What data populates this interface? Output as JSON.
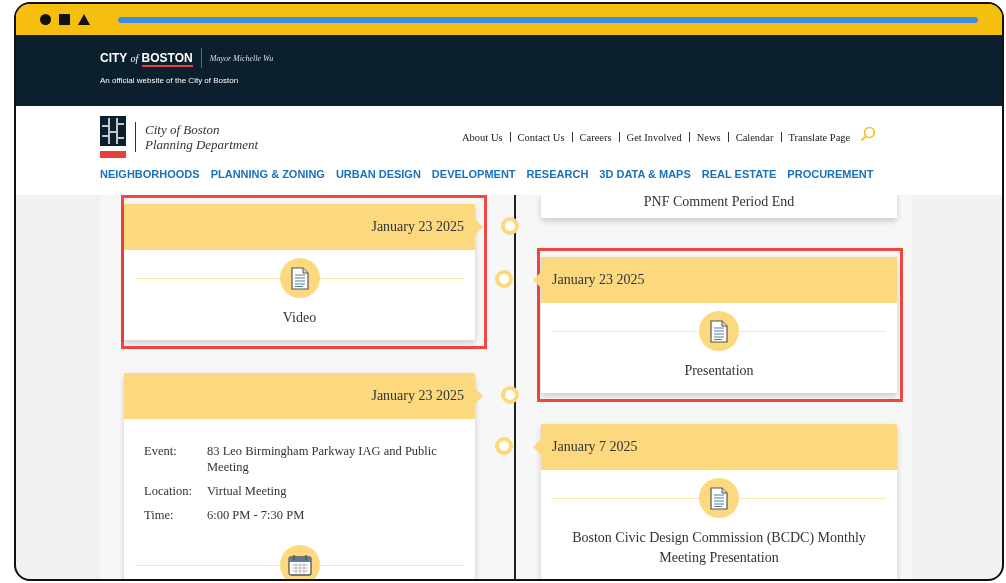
{
  "header": {
    "wordmark": {
      "city": "CITY",
      "of": "of",
      "boston": "BOSTON"
    },
    "mayor": "Mayor Michelle Wu",
    "tagline": "An official website of the City of Boston"
  },
  "nav": {
    "logo_lines": [
      "City of Boston",
      "Planning Department"
    ],
    "utility_links": [
      "About Us",
      "Contact Us",
      "Careers",
      "Get Involved",
      "News",
      "Calendar",
      "Translate Page"
    ],
    "menu": [
      "NEIGHBORHOODS",
      "PLANNING & ZONING",
      "URBAN DESIGN",
      "DEVELOPMENT",
      "RESEARCH",
      "3D DATA & MAPS",
      "REAL ESTATE",
      "PROCUREMENT"
    ]
  },
  "timeline": {
    "left": [
      {
        "kind": "document",
        "date": "January 23 2025",
        "title": "Video",
        "highlighted": true
      },
      {
        "kind": "details",
        "date": "January 23 2025",
        "highlighted": false,
        "details": [
          {
            "label": "Event:",
            "value": "83 Leo Birmingham Parkway IAG and Public Meeting"
          },
          {
            "label": "Location:",
            "value": "Virtual Meeting"
          },
          {
            "label": "Time:",
            "value": "6:00 PM - 7:30 PM"
          }
        ]
      }
    ],
    "right": [
      {
        "kind": "partial",
        "title": "PNF Comment Period End",
        "highlighted": false
      },
      {
        "kind": "document",
        "date": "January 23 2025",
        "title": "Presentation",
        "highlighted": true
      },
      {
        "kind": "document",
        "date": "January 7 2025",
        "title": "Boston Civic Design Commission (BCDC) Monthly Meeting Presentation",
        "highlighted": false
      }
    ]
  }
}
